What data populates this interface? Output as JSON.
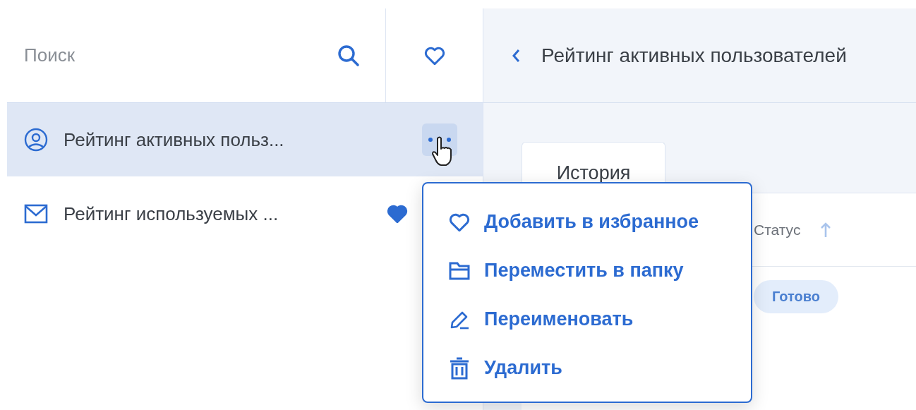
{
  "search": {
    "placeholder": "Поиск"
  },
  "reports": [
    {
      "kind": "user",
      "title": "Рейтинг активных польз...",
      "selected": true,
      "favorite": false
    },
    {
      "kind": "mail",
      "title": "Рейтинг используемых ...",
      "selected": false,
      "favorite": true
    }
  ],
  "header": {
    "title": "Рейтинг активных пользователей"
  },
  "tabs": [
    {
      "label": "История",
      "selected": true
    }
  ],
  "table": {
    "columns": [
      {
        "label": "Статус"
      }
    ],
    "rows": [
      {
        "status": "Готово"
      }
    ]
  },
  "context_menu": {
    "items": [
      {
        "kind": "favorite",
        "label": "Добавить в избранное"
      },
      {
        "kind": "move",
        "label": "Переместить в папку"
      },
      {
        "kind": "rename",
        "label": "Переименовать"
      },
      {
        "kind": "delete",
        "label": "Удалить"
      }
    ]
  }
}
